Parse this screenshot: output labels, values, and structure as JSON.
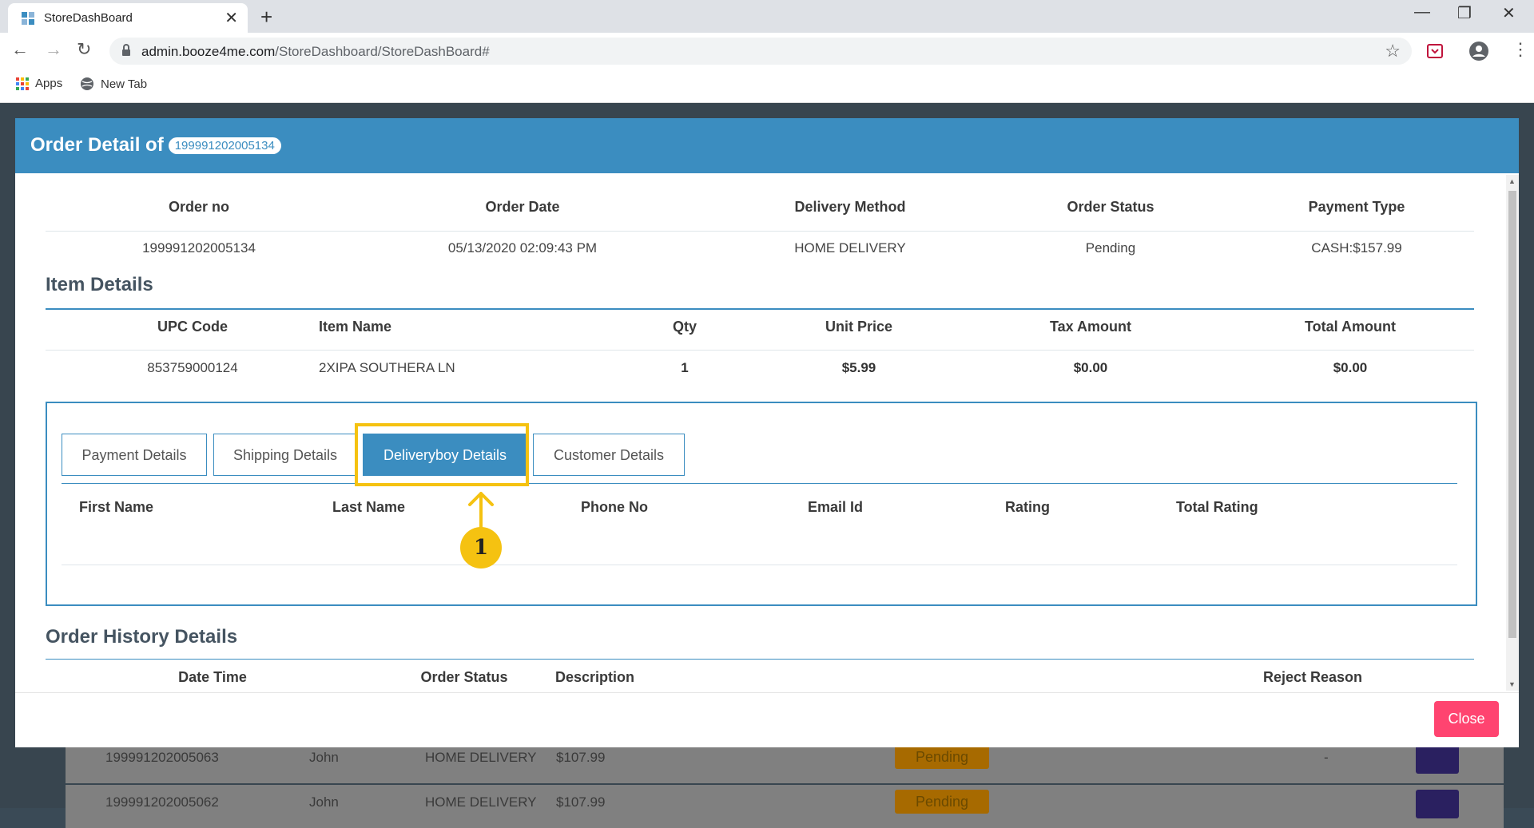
{
  "browser": {
    "tab_title": "StoreDashBoard",
    "url_host": "admin.booze4me.com",
    "url_path": "/StoreDashboard/StoreDashBoard#",
    "bookmarks": [
      "Apps",
      "New Tab"
    ]
  },
  "modal": {
    "title": "Order Detail of",
    "order_badge": "199991202005134",
    "order_headers": [
      "Order no",
      "Order Date",
      "Delivery Method",
      "Order Status",
      "Payment Type"
    ],
    "order_values": [
      "199991202005134",
      "05/13/2020 02:09:43 PM",
      "HOME DELIVERY",
      "Pending",
      "CASH:$157.99"
    ],
    "item_section": "Item Details",
    "item_headers": [
      "UPC Code",
      "Item Name",
      "Qty",
      "Unit Price",
      "Tax Amount",
      "Total Amount"
    ],
    "item_values": [
      "853759000124",
      "2XIPA SOUTHERA LN",
      "1",
      "$5.99",
      "$0.00",
      "$0.00"
    ],
    "tabs": [
      "Payment Details",
      "Shipping Details",
      "Deliveryboy Details",
      "Customer Details"
    ],
    "active_tab": "Deliveryboy Details",
    "delivery_headers": [
      "First Name",
      "Last Name",
      "Phone No",
      "Email Id",
      "Rating",
      "Total Rating"
    ],
    "history_section": "Order History Details",
    "history_headers": [
      "Date Time",
      "Order Status",
      "Description",
      "Reject Reason"
    ],
    "close_label": "Close"
  },
  "annotation": {
    "callout_number": "1"
  },
  "background_rows": [
    {
      "order": "199991202005063",
      "name": "John",
      "method": "HOME DELIVERY",
      "amount": "$107.99",
      "status": "Pending",
      "reason": "-"
    },
    {
      "order": "199991202005062",
      "name": "John",
      "method": "HOME DELIVERY",
      "amount": "$107.99",
      "status": "Pending",
      "reason": "-"
    }
  ],
  "colors": {
    "accent": "#3b8dc0",
    "highlight": "#f5c211",
    "close": "#ff4470"
  }
}
